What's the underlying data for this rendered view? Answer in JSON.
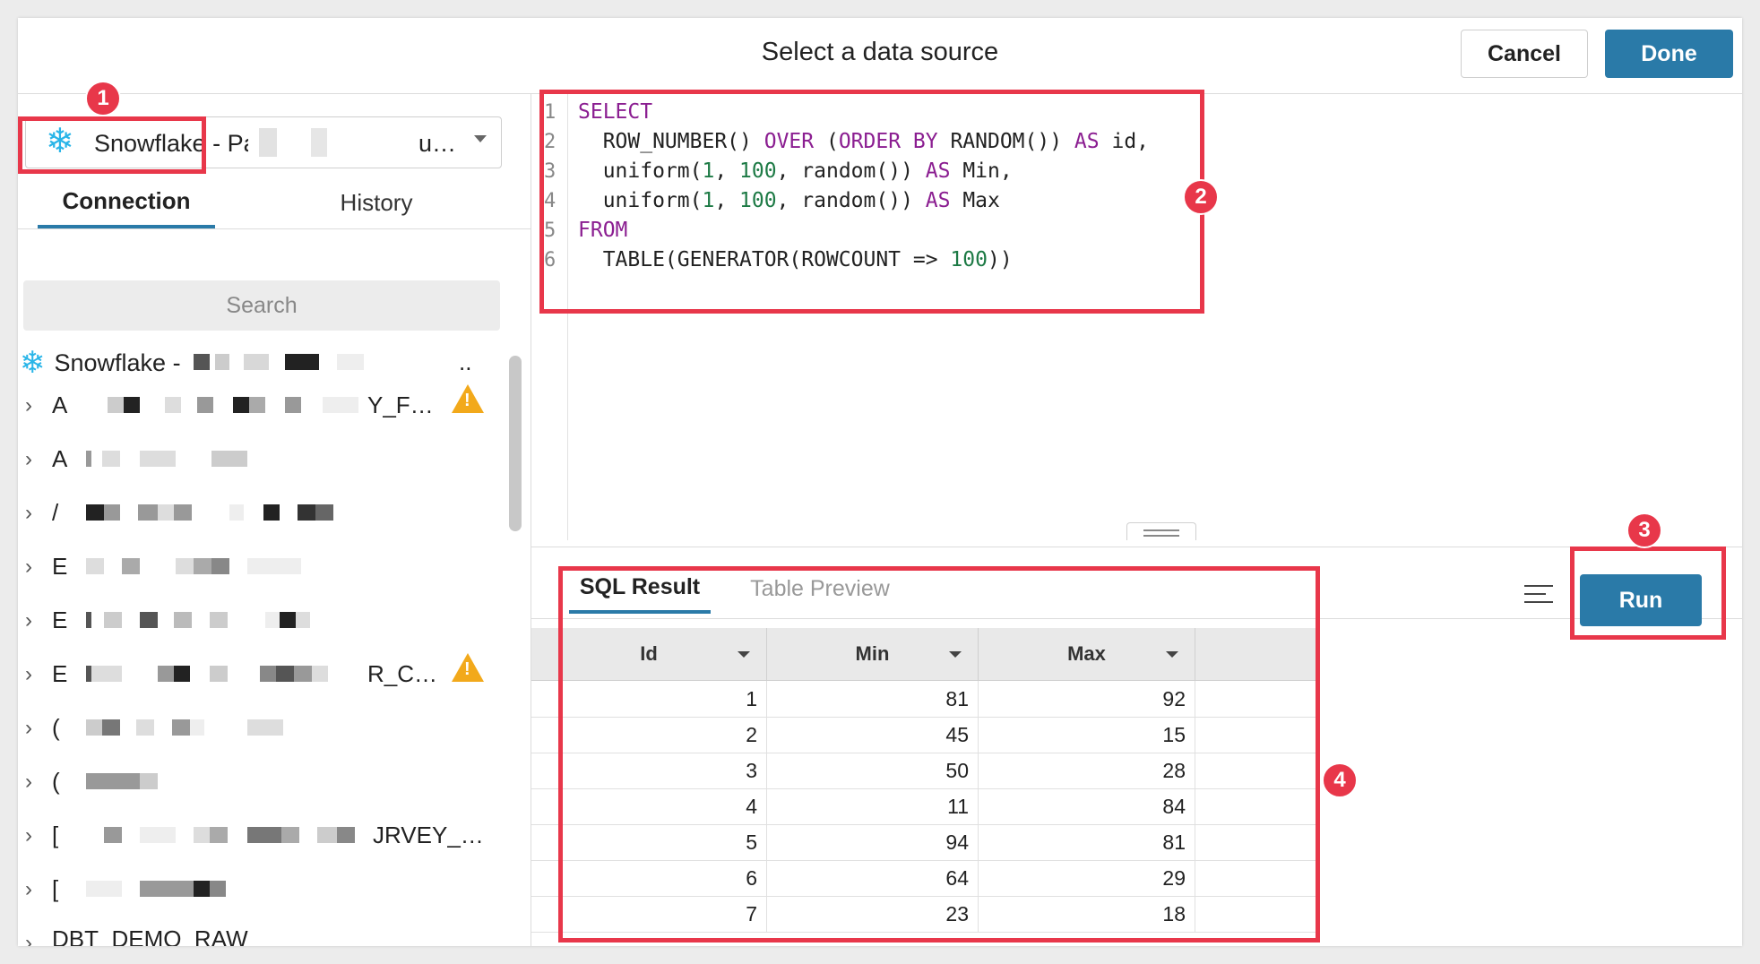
{
  "dialog": {
    "title": "Select a data source",
    "cancel_label": "Cancel",
    "done_label": "Done"
  },
  "source_select": {
    "label": "Snowflake",
    "label_mid": "- Pa",
    "label_tail": "u…",
    "icon": "snowflake-icon"
  },
  "left_tabs": {
    "connection": "Connection",
    "history": "History"
  },
  "search": {
    "placeholder": "Search"
  },
  "tree": {
    "root_label": "Snowflake -",
    "root_tail": "..",
    "items": [
      {
        "prefix": "A",
        "suffix": "Y_F…",
        "warning": true
      },
      {
        "prefix": "A",
        "suffix": "",
        "warning": false
      },
      {
        "prefix": "/",
        "suffix": "",
        "warning": false
      },
      {
        "prefix": "E",
        "suffix": "",
        "warning": false
      },
      {
        "prefix": "E",
        "suffix": "",
        "warning": false
      },
      {
        "prefix": "E",
        "suffix": "R_C…",
        "warning": true
      },
      {
        "prefix": "(",
        "suffix": "",
        "warning": false
      },
      {
        "prefix": "(",
        "suffix": "",
        "warning": false
      },
      {
        "prefix": "[",
        "suffix": "JRVEY_…",
        "warning": false
      },
      {
        "prefix": "[",
        "suffix": "",
        "warning": false
      },
      {
        "prefix": "DBT_DEMO_RAW",
        "suffix": "",
        "warning": false
      }
    ]
  },
  "editor": {
    "line_numbers": [
      "1",
      "2",
      "3",
      "4",
      "5",
      "6"
    ],
    "lines": [
      "SELECT",
      "  ROW_NUMBER() OVER (ORDER BY RANDOM()) AS id,",
      "  uniform(1, 100, random()) AS Min,",
      "  uniform(1, 100, random()) AS Max",
      "FROM",
      "  TABLE(GENERATOR(ROWCOUNT => 100))"
    ]
  },
  "results": {
    "tab_sql": "SQL Result",
    "tab_preview": "Table Preview",
    "run_label": "Run",
    "columns": [
      "Id",
      "Min",
      "Max"
    ],
    "rows": [
      [
        "1",
        "81",
        "92"
      ],
      [
        "2",
        "45",
        "15"
      ],
      [
        "3",
        "50",
        "28"
      ],
      [
        "4",
        "11",
        "84"
      ],
      [
        "5",
        "94",
        "81"
      ],
      [
        "6",
        "64",
        "29"
      ],
      [
        "7",
        "23",
        "18"
      ]
    ]
  },
  "annotations": {
    "badge_1": "1",
    "badge_2": "2",
    "badge_3": "3",
    "badge_4": "4",
    "color": "#e8374a"
  },
  "colors": {
    "accent": "#2a7aa8",
    "keyword": "#8b1e91",
    "number": "#1d7a45",
    "snowflake": "#29b5e8",
    "warning": "#f2a91b"
  }
}
